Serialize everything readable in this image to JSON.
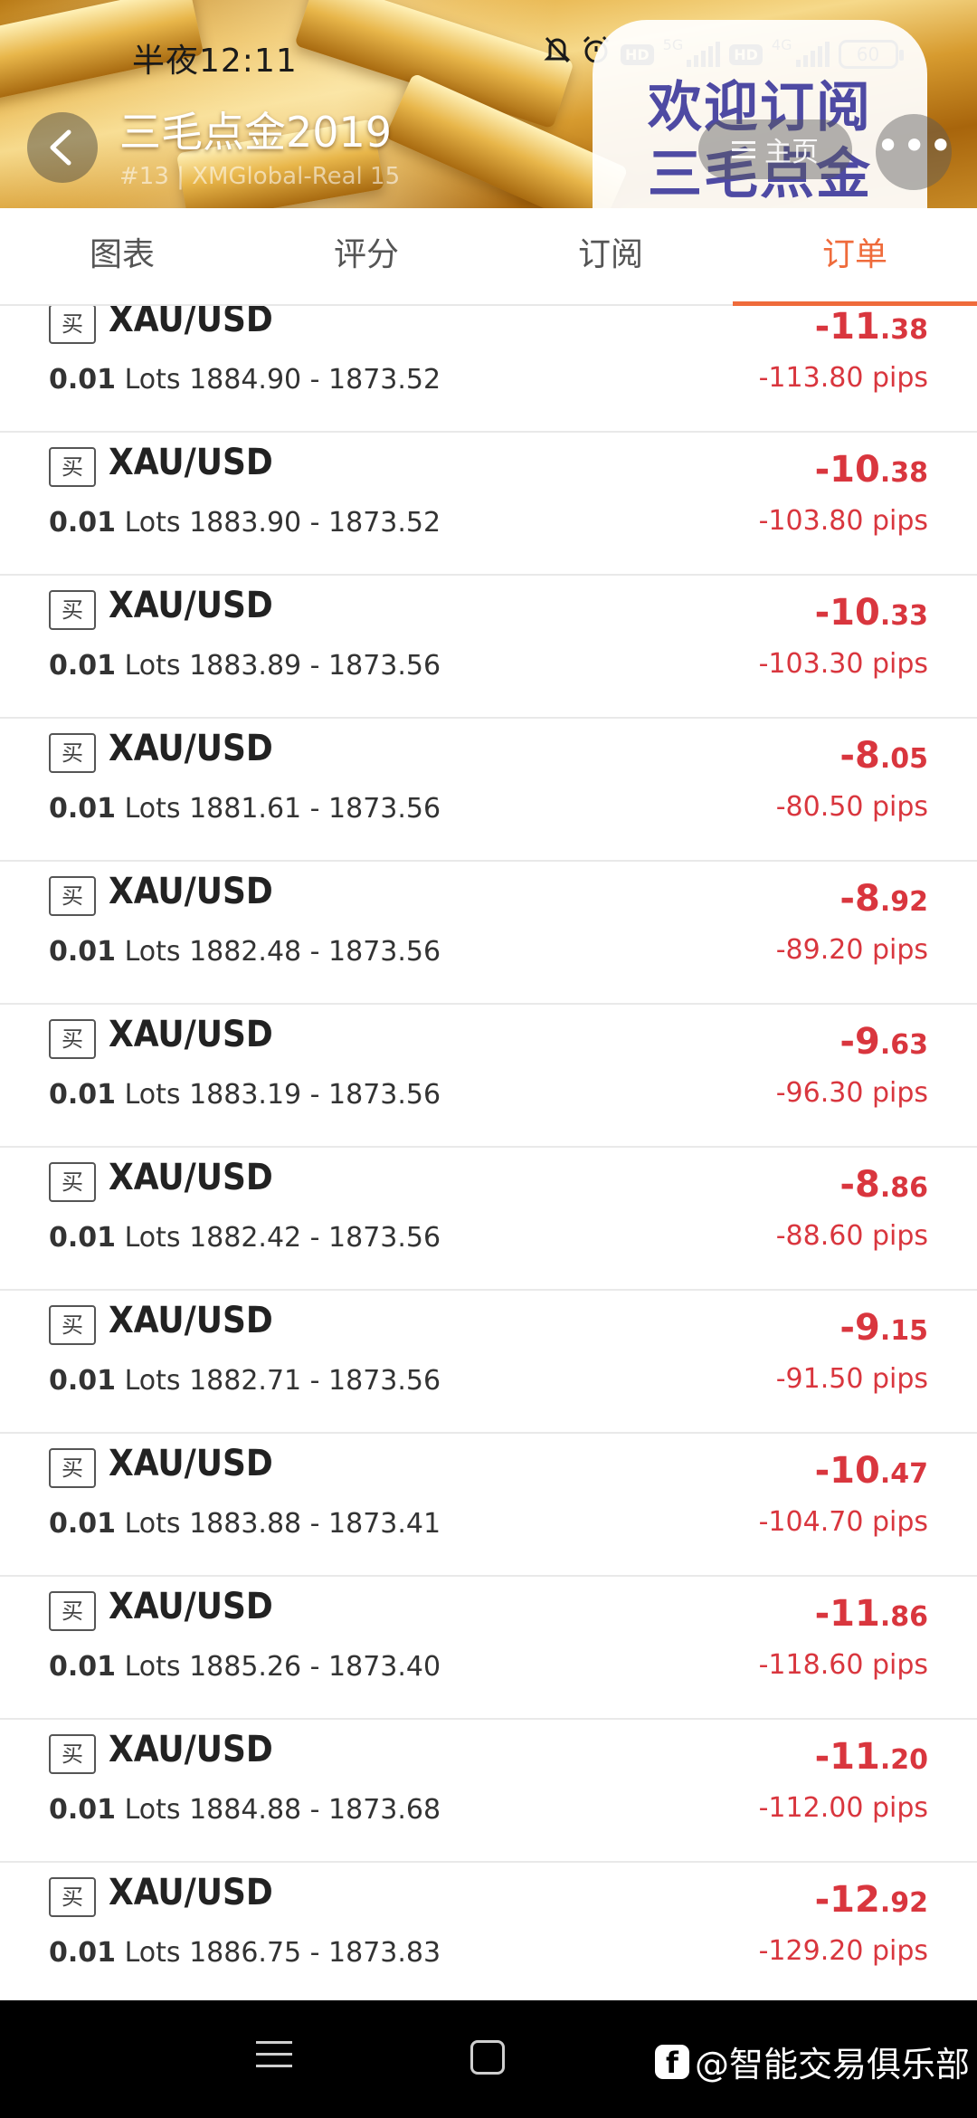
{
  "status_bar": {
    "time": "半夜12:11",
    "net_5g": "5G",
    "net_4g": "4G",
    "hd": "HD",
    "battery": "60",
    "icons": [
      "bell-off-icon",
      "alarm-icon",
      "signal-icon",
      "battery-icon"
    ]
  },
  "header": {
    "title": "三毛点金2019",
    "subtitle": "#13 | XMGlobal-Real 15",
    "home_label": "主页",
    "more_label": "•••",
    "promo_lines": [
      "欢迎订阅",
      "三毛点金"
    ]
  },
  "tabs": [
    {
      "label": "图表",
      "active": false
    },
    {
      "label": "评分",
      "active": false
    },
    {
      "label": "订阅",
      "active": false
    },
    {
      "label": "订单",
      "active": true
    }
  ],
  "orders": [
    {
      "type": "买",
      "symbol": "XAU/USD",
      "lots": "0.01",
      "lots_unit": "Lots",
      "open": "1884.90",
      "close": "1873.52",
      "profit_int": "-11",
      "profit_dec": ".38",
      "pips": "-113.80 pips"
    },
    {
      "type": "买",
      "symbol": "XAU/USD",
      "lots": "0.01",
      "lots_unit": "Lots",
      "open": "1883.90",
      "close": "1873.52",
      "profit_int": "-10",
      "profit_dec": ".38",
      "pips": "-103.80 pips"
    },
    {
      "type": "买",
      "symbol": "XAU/USD",
      "lots": "0.01",
      "lots_unit": "Lots",
      "open": "1883.89",
      "close": "1873.56",
      "profit_int": "-10",
      "profit_dec": ".33",
      "pips": "-103.30 pips"
    },
    {
      "type": "买",
      "symbol": "XAU/USD",
      "lots": "0.01",
      "lots_unit": "Lots",
      "open": "1881.61",
      "close": "1873.56",
      "profit_int": "-8",
      "profit_dec": ".05",
      "pips": "-80.50 pips"
    },
    {
      "type": "买",
      "symbol": "XAU/USD",
      "lots": "0.01",
      "lots_unit": "Lots",
      "open": "1882.48",
      "close": "1873.56",
      "profit_int": "-8",
      "profit_dec": ".92",
      "pips": "-89.20 pips"
    },
    {
      "type": "买",
      "symbol": "XAU/USD",
      "lots": "0.01",
      "lots_unit": "Lots",
      "open": "1883.19",
      "close": "1873.56",
      "profit_int": "-9",
      "profit_dec": ".63",
      "pips": "-96.30 pips"
    },
    {
      "type": "买",
      "symbol": "XAU/USD",
      "lots": "0.01",
      "lots_unit": "Lots",
      "open": "1882.42",
      "close": "1873.56",
      "profit_int": "-8",
      "profit_dec": ".86",
      "pips": "-88.60 pips"
    },
    {
      "type": "买",
      "symbol": "XAU/USD",
      "lots": "0.01",
      "lots_unit": "Lots",
      "open": "1882.71",
      "close": "1873.56",
      "profit_int": "-9",
      "profit_dec": ".15",
      "pips": "-91.50 pips"
    },
    {
      "type": "买",
      "symbol": "XAU/USD",
      "lots": "0.01",
      "lots_unit": "Lots",
      "open": "1883.88",
      "close": "1873.41",
      "profit_int": "-10",
      "profit_dec": ".47",
      "pips": "-104.70 pips"
    },
    {
      "type": "买",
      "symbol": "XAU/USD",
      "lots": "0.01",
      "lots_unit": "Lots",
      "open": "1885.26",
      "close": "1873.40",
      "profit_int": "-11",
      "profit_dec": ".86",
      "pips": "-118.60 pips"
    },
    {
      "type": "买",
      "symbol": "XAU/USD",
      "lots": "0.01",
      "lots_unit": "Lots",
      "open": "1884.88",
      "close": "1873.68",
      "profit_int": "-11",
      "profit_dec": ".20",
      "pips": "-112.00 pips"
    },
    {
      "type": "买",
      "symbol": "XAU/USD",
      "lots": "0.01",
      "lots_unit": "Lots",
      "open": "1886.75",
      "close": "1873.83",
      "profit_int": "-12",
      "profit_dec": ".92",
      "pips": "-129.20 pips"
    }
  ],
  "watermark": {
    "icon": "facebook-icon",
    "icon_glyph": "f",
    "text": "@智能交易俱乐部"
  },
  "colors": {
    "accent": "#ef6b3b",
    "loss": "#d9363e",
    "promo": "#4e4aa3"
  }
}
